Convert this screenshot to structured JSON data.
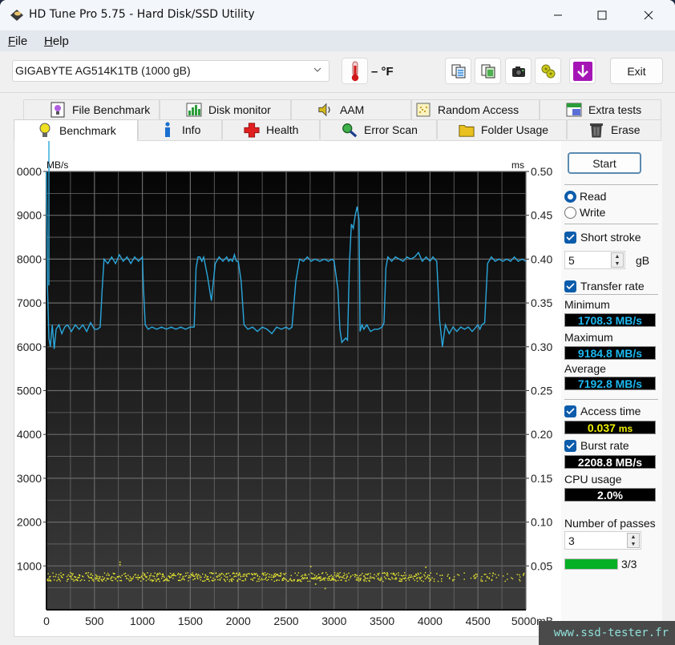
{
  "window": {
    "title": "HD Tune Pro 5.75 - Hard Disk/SSD Utility",
    "controls": {
      "minimize": "minimize",
      "maximize": "maximize",
      "close": "close"
    }
  },
  "menu": [
    {
      "label_u": "F",
      "label_rest": "ile"
    },
    {
      "label_u": "H",
      "label_rest": "elp"
    }
  ],
  "toolbar": {
    "drive": "GIGABYTE AG514K1TB (1000 gB)",
    "temperature": "– °F",
    "icons": [
      "copy-text-icon",
      "copy-image-icon",
      "camera-icon",
      "options-icon",
      "save-down-icon"
    ],
    "exit_label": "Exit"
  },
  "tabs": {
    "top": [
      {
        "label": "File Benchmark",
        "icon": "file-benchmark-icon"
      },
      {
        "label": "Disk monitor",
        "icon": "disk-monitor-icon"
      },
      {
        "label": "AAM",
        "icon": "speaker-icon"
      },
      {
        "label": "Random Access",
        "icon": "random-access-icon"
      },
      {
        "label": "Extra tests",
        "icon": "extra-tests-icon"
      }
    ],
    "bottom": [
      {
        "label": "Benchmark",
        "icon": "bulb-icon",
        "active": true
      },
      {
        "label": "Info",
        "icon": "info-icon"
      },
      {
        "label": "Health",
        "icon": "health-cross-icon"
      },
      {
        "label": "Error Scan",
        "icon": "magnifier-icon"
      },
      {
        "label": "Folder Usage",
        "icon": "folder-icon"
      },
      {
        "label": "Erase",
        "icon": "trash-icon"
      }
    ]
  },
  "side": {
    "start_label": "Start",
    "read_label": "Read",
    "write_label": "Write",
    "mode_selected": "Read",
    "short_stroke_label": "Short stroke",
    "short_stroke_checked": true,
    "short_stroke_value": "5",
    "short_stroke_unit": "gB",
    "transfer_rate_label": "Transfer rate",
    "transfer_rate_checked": true,
    "minimum_label": "Minimum",
    "minimum_value": "1708.3 MB/s",
    "maximum_label": "Maximum",
    "maximum_value": "9184.8 MB/s",
    "average_label": "Average",
    "average_value": "7192.8 MB/s",
    "access_time_label": "Access time",
    "access_time_checked": true,
    "access_time_value": "0.037",
    "access_time_unit": "ms",
    "burst_rate_label": "Burst rate",
    "burst_rate_checked": true,
    "burst_rate_value": "2208.8 MB/s",
    "cpu_usage_label": "CPU usage",
    "cpu_usage_value": "2.0%",
    "passes_label": "Number of passes",
    "passes_value": "3",
    "passes_progress": 1.0,
    "passes_progress_text": "3/3",
    "progress_color": "#06b025"
  },
  "watermark": "www.ssd-tester.fr",
  "chart_data": {
    "type": "line",
    "title": "",
    "xlabel": "mB",
    "ylabel_left": "MB/s",
    "ylabel_right": "ms",
    "xlim": [
      0,
      5000
    ],
    "ylim_left": [
      0,
      10000
    ],
    "ylim_right": [
      0,
      0.5
    ],
    "x_ticks": [
      "0",
      "500",
      "1000",
      "1500",
      "2000",
      "2500",
      "3000",
      "3500",
      "4000",
      "4500",
      "5000mB"
    ],
    "y_ticks_left": [
      "0000",
      "9000",
      "8000",
      "7000",
      "6000",
      "5000",
      "4000",
      "3000",
      "2000",
      "1000"
    ],
    "y_ticks_right": [
      "0.50",
      "0.45",
      "0.40",
      "0.35",
      "0.30",
      "0.25",
      "0.20",
      "0.15",
      "0.10",
      "0.05"
    ],
    "grid": true,
    "colors": {
      "transfer": "#2aa7dc",
      "access": "#e8e830",
      "grid": "#6a6a6a"
    },
    "series": [
      {
        "name": "Transfer rate (MB/s)",
        "x": [
          0,
          10,
          25,
          40,
          60,
          80,
          100,
          130,
          160,
          190,
          220,
          260,
          300,
          340,
          380,
          420,
          460,
          500,
          530,
          560,
          580,
          600,
          640,
          680,
          720,
          760,
          800,
          840,
          880,
          920,
          960,
          1000,
          1010,
          1030,
          1060,
          1100,
          1150,
          1200,
          1250,
          1300,
          1350,
          1400,
          1450,
          1500,
          1540,
          1560,
          1580,
          1600,
          1620,
          1640,
          1680,
          1720,
          1760,
          1800,
          1840,
          1880,
          1900,
          1920,
          1940,
          1960,
          1980,
          2000,
          2030,
          2060,
          2100,
          2150,
          2200,
          2250,
          2300,
          2350,
          2400,
          2450,
          2500,
          2530,
          2560,
          2600,
          2640,
          2680,
          2720,
          2760,
          2800,
          2850,
          2900,
          2940,
          2980,
          3000,
          3040,
          3060,
          3080,
          3100,
          3120,
          3140,
          3160,
          3180,
          3200,
          3220,
          3240,
          3260,
          3270,
          3290,
          3310,
          3340,
          3380,
          3420,
          3460,
          3500,
          3520,
          3540,
          3560,
          3600,
          3640,
          3680,
          3720,
          3760,
          3800,
          3840,
          3880,
          3920,
          3960,
          4000,
          4030,
          4050,
          4070,
          4100,
          4130,
          4160,
          4200,
          4240,
          4280,
          4320,
          4360,
          4400,
          4440,
          4480,
          4500,
          4520,
          4540,
          4570,
          4600,
          4640,
          4680,
          4720,
          4760,
          4800,
          4840,
          4880,
          4920,
          4960,
          5000
        ],
        "y": [
          10000,
          7400,
          6200,
          6000,
          6500,
          5950,
          6400,
          6500,
          6300,
          6450,
          6500,
          6350,
          6500,
          6400,
          6500,
          6350,
          6550,
          6400,
          6400,
          6450,
          7300,
          8000,
          7900,
          8050,
          7900,
          8100,
          7950,
          8050,
          7900,
          8050,
          7950,
          8050,
          7400,
          6500,
          6400,
          6450,
          6400,
          6450,
          6400,
          6450,
          6400,
          6450,
          6400,
          6450,
          6450,
          7800,
          8050,
          8050,
          7950,
          8050,
          7600,
          7050,
          7900,
          8050,
          7950,
          8050,
          7950,
          8000,
          7950,
          8100,
          7950,
          7950,
          7500,
          6500,
          6400,
          6450,
          6350,
          6450,
          6400,
          6300,
          6450,
          6400,
          6450,
          6400,
          6450,
          7500,
          8000,
          7950,
          8050,
          7950,
          8000,
          7950,
          8000,
          7950,
          8000,
          7950,
          7300,
          6400,
          6100,
          6150,
          6200,
          6150,
          7900,
          8800,
          8700,
          9000,
          9200,
          8900,
          6350,
          6500,
          6400,
          6500,
          6350,
          6400,
          6400,
          6450,
          6550,
          7800,
          8050,
          7950,
          8050,
          8000,
          7950,
          8050,
          8000,
          8050,
          8150,
          7950,
          8050,
          7950,
          8050,
          8000,
          7950,
          6600,
          6000,
          6500,
          6300,
          6450,
          6350,
          6450,
          6400,
          6450,
          6350,
          6450,
          6500,
          6400,
          6500,
          6550,
          7900,
          8050,
          7950,
          8000,
          7950,
          8000,
          7950,
          8050,
          7950,
          8000,
          7950,
          8050
        ]
      },
      {
        "name": "Access time (ms)",
        "description": "scatter of dots concentrated between ~0.033 and ~0.043 ms across 0–5000 mB, density decreasing after ~4000 mB; a few outliers up to ~0.055 near 760 mB and 3950 mB and down to ~0.025 near 2900 mB",
        "typical_range": [
          0.033,
          0.043
        ],
        "outliers": [
          {
            "x": 760,
            "y": 0.055
          },
          {
            "x": 760,
            "y": 0.052
          },
          {
            "x": 2750,
            "y": 0.05
          },
          {
            "x": 2800,
            "y": 0.03
          },
          {
            "x": 2900,
            "y": 0.025
          },
          {
            "x": 3950,
            "y": 0.049
          }
        ]
      }
    ]
  }
}
